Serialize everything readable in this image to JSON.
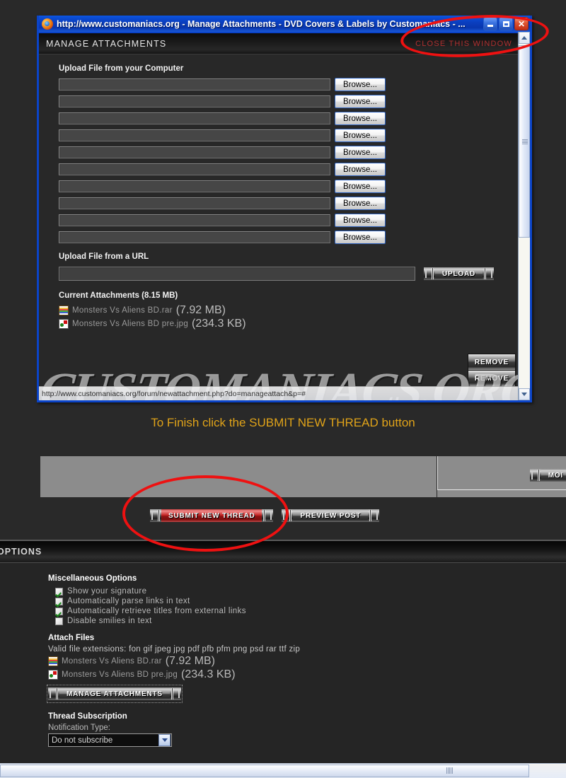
{
  "popup": {
    "title": "http://www.customaniacs.org - Manage Attachments - DVD Covers & Labels by Customaniacs - ...",
    "header_title": "MANAGE ATTACHMENTS",
    "close_link": "CLOSE THIS WINDOW",
    "upload_computer_label": "Upload File from your Computer",
    "browse_label": "Browse...",
    "file_rows": 10,
    "upload_url_label": "Upload File from a URL",
    "upload_button": "UPLOAD",
    "current_attachments_label": "Current Attachments (8.15 MB)",
    "attachments": [
      {
        "icon": "rar-file-icon",
        "name": "Monsters Vs Aliens BD.rar",
        "size": "(7.92 MB)",
        "remove_label": "REMOVE"
      },
      {
        "icon": "jpg-file-icon",
        "name": "Monsters Vs Aliens BD pre.jpg",
        "size": "(234.3 KB)",
        "remove_label": "REMOVE"
      }
    ],
    "status_url": "http://www.customaniacs.org/forum/newattachment.php?do=manageattach&p=#",
    "watermark": "CUSTOMANIACS.ORG",
    "window_buttons": {
      "minimize": "minimize-button",
      "maximize": "maximize-button",
      "close": "close-button"
    }
  },
  "page": {
    "finish_instruction": "To Finish click the SUBMIT NEW THREAD button",
    "more_button": "MOI",
    "submit_button": "SUBMIT NEW THREAD",
    "preview_button": "PREVIEW POST",
    "options_header": "OPTIONS",
    "misc_options_title": "Miscellaneous Options",
    "misc_options": [
      {
        "label": "Show your signature",
        "checked": true
      },
      {
        "label": "Automatically parse links in text",
        "checked": true
      },
      {
        "label": "Automatically retrieve titles from external links",
        "checked": true
      },
      {
        "label": "Disable smilies in text",
        "checked": false
      }
    ],
    "attach_files_title": "Attach Files",
    "valid_extensions": "Valid file extensions: fon gif jpeg jpg pdf pfb pfm png psd rar ttf zip",
    "attached_files": [
      {
        "icon": "rar-file-icon",
        "name": "Monsters Vs Aliens BD.rar",
        "size": "(7.92 MB)"
      },
      {
        "icon": "jpg-file-icon",
        "name": "Monsters Vs Aliens BD pre.jpg",
        "size": "(234.3 KB)"
      }
    ],
    "manage_attachments_button": "MANAGE ATTACHMENTS",
    "thread_subscription_title": "Thread Subscription",
    "notification_type_label": "Notification Type:",
    "notification_value": "Do not subscribe"
  },
  "colors": {
    "accent_orange": "#e0a319",
    "annotation_red": "#ee1111",
    "titlebar_blue": "#0a3fc0",
    "submit_red": "#c32222"
  }
}
